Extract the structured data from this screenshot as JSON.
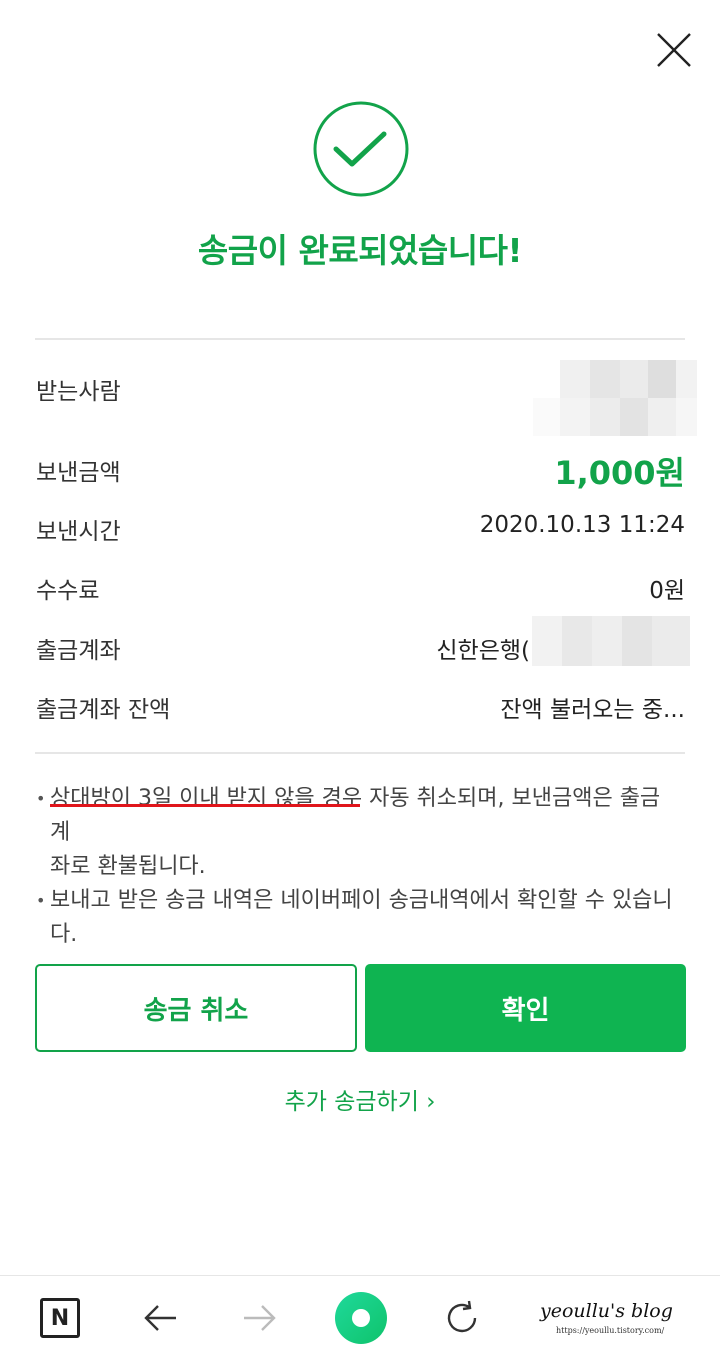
{
  "header": {
    "close_label": "close"
  },
  "result": {
    "title": "송금이 완료되었습니다!"
  },
  "details": {
    "recipient_label": "받는사람",
    "amount_label": "보낸금액",
    "amount_value": "1,000원",
    "time_label": "보낸시간",
    "time_value": "2020.10.13 11:24",
    "fee_label": "수수료",
    "fee_value": "0원",
    "account_label": "출금계좌",
    "account_value": "신한은행(",
    "balance_label": "출금계좌 잔액",
    "balance_value": "잔액 불러오는 중..."
  },
  "notes": [
    {
      "line1": "상대방이 3일 이내 받지 않을 경우 자동 취소되며, 보낸금액은 출금 계",
      "line2": "좌로 환불됩니다."
    },
    {
      "line1": "보내고 받은 송금 내역은 네이버페이 송금내역에서 확인할 수 있습니",
      "line2": "다."
    }
  ],
  "actions": {
    "cancel_label": "송금 취소",
    "confirm_label": "확인",
    "more_label": "추가 송금하기 ›"
  },
  "bottom_nav": {
    "home_label": "N",
    "watermark": "yeoullu's blog",
    "watermark_url": "https://yeoullu.tistory.com/"
  },
  "colors": {
    "accent": "#12a34a",
    "button_green": "#0fb451",
    "underline": "#e0151b"
  }
}
